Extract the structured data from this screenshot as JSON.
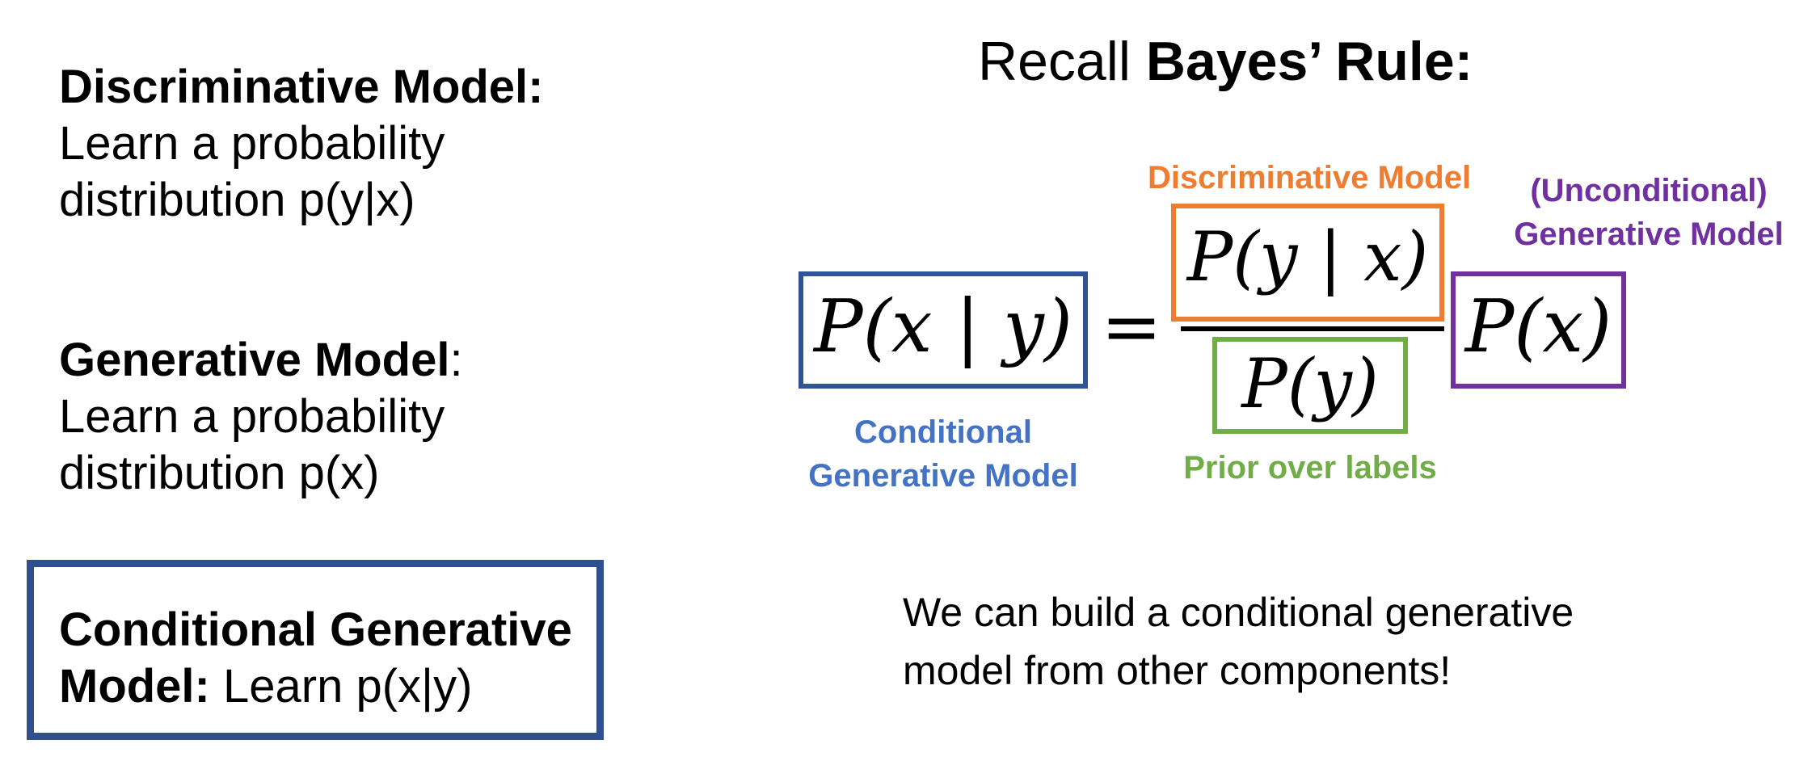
{
  "discriminative": {
    "title": "Discriminative Model:",
    "line1": "Learn a probability",
    "line2": "distribution p(y|x)"
  },
  "generative": {
    "title": "Generative Model",
    "colon": ":",
    "line1": "Learn a probability",
    "line2": "distribution p(x)"
  },
  "conditional": {
    "title_line1": "Conditional Generative",
    "title_line2": "Model:",
    "rest": "Learn p(x|y)"
  },
  "bayes": {
    "prefix": "Recall",
    "title": "Bayes’ Rule:"
  },
  "equation": {
    "lhs": "P(x | y)",
    "equals": "=",
    "numerator": "P(y | x)",
    "denominator": "P(y)",
    "rhs_factor": "P(x)"
  },
  "labels": {
    "discriminative": "Discriminative Model",
    "unconditional_line1": "(Unconditional)",
    "unconditional_line2": "Generative Model",
    "conditional_line1": "Conditional",
    "conditional_line2": "Generative Model",
    "prior": "Prior over labels"
  },
  "note": {
    "line1": "We can build a conditional generative",
    "line2": "model from other components!"
  },
  "colors": {
    "conditional": "#4472c4",
    "discriminative": "#ed7d31",
    "prior": "#70ad47",
    "unconditional": "#7030a0",
    "conditional_box_border": "#2f4f8f"
  }
}
